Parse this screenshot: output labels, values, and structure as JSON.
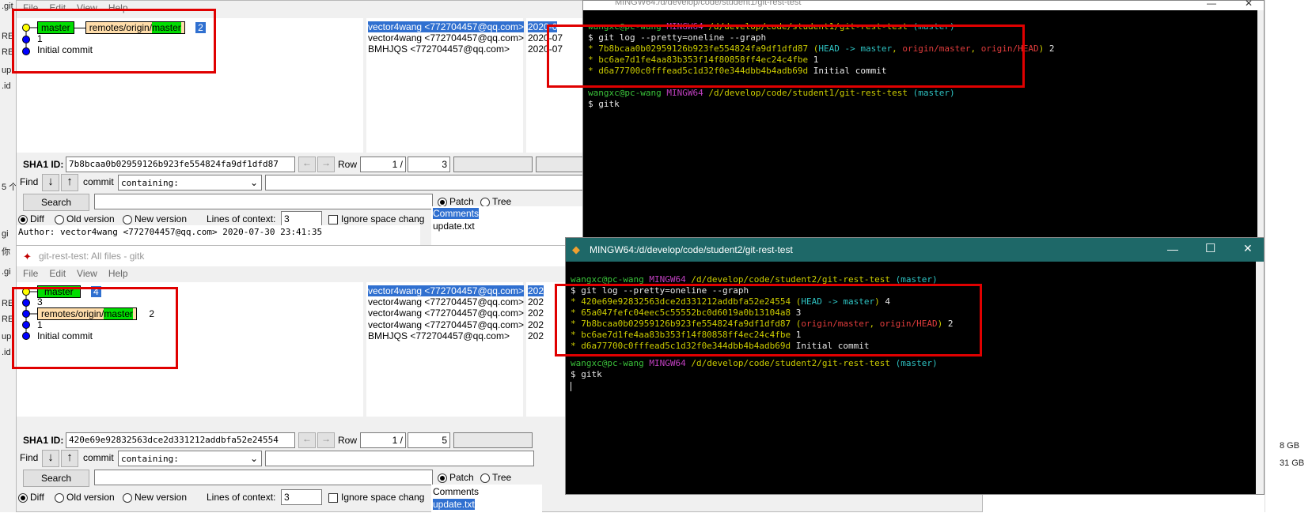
{
  "background": {
    "left_fragments": [
      ".git",
      "RE",
      "RE",
      "up",
      ".id",
      "5 个",
      "gi",
      "你",
      ".gi",
      "RE",
      "RE",
      "up",
      ".id"
    ],
    "right_fragments": [
      "8 GB",
      "31 GB"
    ]
  },
  "gitk_top": {
    "menu": [
      "File",
      "Edit",
      "View",
      "Help"
    ],
    "branch_tag": "master",
    "remote_tag_prefix": "remotes/origin/",
    "remote_tag_branch": "master",
    "head_row_num": "2",
    "commits": [
      "1",
      "Initial commit"
    ],
    "authors": [
      "vector4wang <772704457@qq.com>",
      "vector4wang <772704457@qq.com>",
      "BMHJQS <772704457@qq.com>"
    ],
    "dates": [
      "2020-0",
      "2020-07",
      "2020-07"
    ],
    "sha1_label": "SHA1 ID:",
    "sha1_value": "7b8bcaa0b02959126b923fe554824fa9df1dfd87",
    "row_label": "Row",
    "row_current": "1 /",
    "row_total": "3",
    "find_label": "Find",
    "commit_label": "commit",
    "containing": "containing:",
    "search_btn": "Search",
    "patch_label": "Patch",
    "tree_label": "Tree",
    "diff_label": "Diff",
    "old_label": "Old version",
    "new_label": "New version",
    "context_label": "Lines of context:",
    "context_value": "3",
    "ignore_label": "Ignore space chang",
    "comments_label": "Comments",
    "file_item": "update.txt",
    "author_line": "Author: vector4wang <772704457@qq.com>  2020-07-30 23:41:35"
  },
  "gitk_bottom": {
    "title": "git-rest-test: All files - gitk",
    "menu": [
      "File",
      "Edit",
      "View",
      "Help"
    ],
    "branch_tag": "master",
    "head_row_num": "4",
    "commit_3": "3",
    "remote_tag_prefix": "remotes/origin/",
    "remote_tag_branch": "master",
    "commit_2": "2",
    "commit_1": "1",
    "commit_0": "Initial commit",
    "authors": [
      "vector4wang <772704457@qq.com>",
      "vector4wang <772704457@qq.com>",
      "vector4wang <772704457@qq.com>",
      "vector4wang <772704457@qq.com>",
      "BMHJQS <772704457@qq.com>"
    ],
    "dates": [
      "202",
      "202",
      "202",
      "202",
      "202"
    ],
    "sha1_label": "SHA1 ID:",
    "sha1_value": "420e69e92832563dce2d331212addbfa52e24554",
    "row_label": "Row",
    "row_current": "1 /",
    "row_total": "5",
    "find_label": "Find",
    "commit_label": "commit",
    "containing": "containing:",
    "search_btn": "Search",
    "patch_label": "Patch",
    "tree_label": "Tree",
    "diff_label": "Diff",
    "old_label": "Old version",
    "new_label": "New version",
    "context_label": "Lines of context:",
    "context_value": "3",
    "ignore_label": "Ignore space chang",
    "comments_label": "Comments",
    "file_item": "update.txt"
  },
  "term_top": {
    "title": "MINGW64:/d/develop/code/student1/git-rest-test",
    "prompt_user": "wangxc@pc-wang",
    "prompt_env": "MINGW64",
    "prompt_path": "/d/develop/code/student1/git-rest-test",
    "prompt_branch": "(master)",
    "cmd1": "$ git log --pretty=oneline --graph",
    "log": [
      {
        "hash": "* 7b8bcaa0b02959126b923fe554824fa9df1dfd87",
        "refs_open": " (",
        "head": "HEAD -> master",
        "sep1": ", ",
        "r1": "origin/master",
        "sep2": ", ",
        "r2": "origin/HEAD",
        "refs_close": ")",
        "msg": " 2"
      },
      {
        "hash": "* bc6ae7d1fe4aa83b353f14f80858ff4ec24c4fbe",
        "msg": " 1"
      },
      {
        "hash": "* d6a77700c0fffead5c1d32f0e344dbb4b4adb69d",
        "msg": " Initial commit"
      }
    ],
    "cmd2": "$ gitk"
  },
  "term_bottom": {
    "title": "MINGW64:/d/develop/code/student2/git-rest-test",
    "prompt_user": "wangxc@pc-wang",
    "prompt_env": "MINGW64",
    "prompt_path": "/d/develop/code/student2/git-rest-test",
    "prompt_branch": "(master)",
    "cmd1": "$ git log --pretty=oneline --graph",
    "log": [
      {
        "hash": "* 420e69e92832563dce2d331212addbfa52e24554",
        "refs_open": " (",
        "head": "HEAD -> master",
        "refs_close": ")",
        "msg": " 4"
      },
      {
        "hash": "* 65a047fefc04eec5c55552bc0d6019a0b13104a8",
        "msg": " 3"
      },
      {
        "hash": "* 7b8bcaa0b02959126b923fe554824fa9df1dfd87",
        "refs_open": " (",
        "r1": "origin/master",
        "sep1": ", ",
        "r2": "origin/HEAD",
        "refs_close": ")",
        "msg": " 2"
      },
      {
        "hash": "* bc6ae7d1fe4aa83b353f14f80858ff4ec24c4fbe",
        "msg": " 1"
      },
      {
        "hash": "* d6a77700c0fffead5c1d32f0e344dbb4b4adb69d",
        "msg": " Initial commit"
      }
    ],
    "cmd2": "$ gitk"
  },
  "colors": {
    "annotation_red": "#e00000",
    "terminal_title": "#1e6868",
    "branch_green": "#00dd00",
    "remote_tan": "#ffddaa"
  }
}
